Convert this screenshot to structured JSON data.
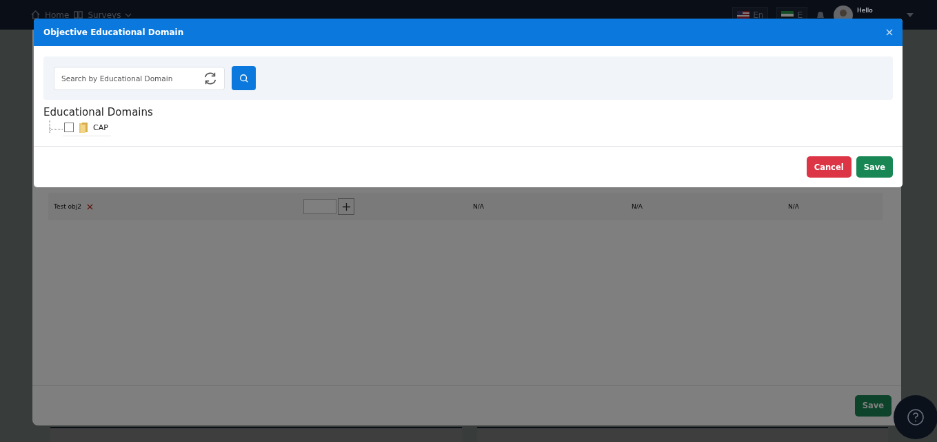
{
  "navbar": {
    "home": "Home",
    "surveys": "Surveys",
    "language": "En",
    "second_language": "E",
    "greeting": "Hello"
  },
  "page": {
    "rows": [
      {
        "name": "Test obj2",
        "cells": [
          "N/A",
          "N/A",
          "N/A"
        ]
      }
    ],
    "save": "Save"
  },
  "modal": {
    "title": "Objective Educational Domain",
    "search": {
      "placeholder": "Search by Educational Domain"
    },
    "heading": "Educational Domains",
    "tree": [
      {
        "label": "CAP",
        "checked": false,
        "expanded": false
      }
    ],
    "buttons": [
      {
        "label": "Cancel",
        "kind": "danger"
      },
      {
        "label": "Save",
        "kind": "success"
      }
    ]
  }
}
